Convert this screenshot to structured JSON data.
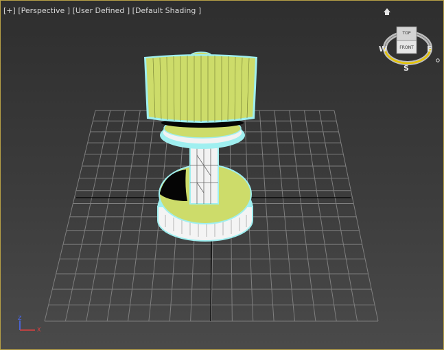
{
  "viewport": {
    "labels": {
      "plus_menu": "[+]",
      "view_menu": "[Perspective ]",
      "user_defined": "[User Defined ]",
      "shading_menu": "[Default Shading ]"
    }
  },
  "viewcube": {
    "top_face": "TOP",
    "front_face": "FRONT",
    "compass": {
      "west": "W",
      "east": "E",
      "south": "S"
    }
  },
  "axis_tripod": {
    "z": "Z",
    "x": "X"
  },
  "colors": {
    "border_active": "#b7a046",
    "object_fill": "#cddc6a",
    "selection_outline": "#9feff0",
    "grid": "#7f7f7f",
    "grid_center": "#000000",
    "axis_z": "#4a6cff",
    "axis_x": "#e04040"
  },
  "scene": {
    "grid": "home-grid",
    "object": "lamp (selected, wireframe on shaded)"
  }
}
